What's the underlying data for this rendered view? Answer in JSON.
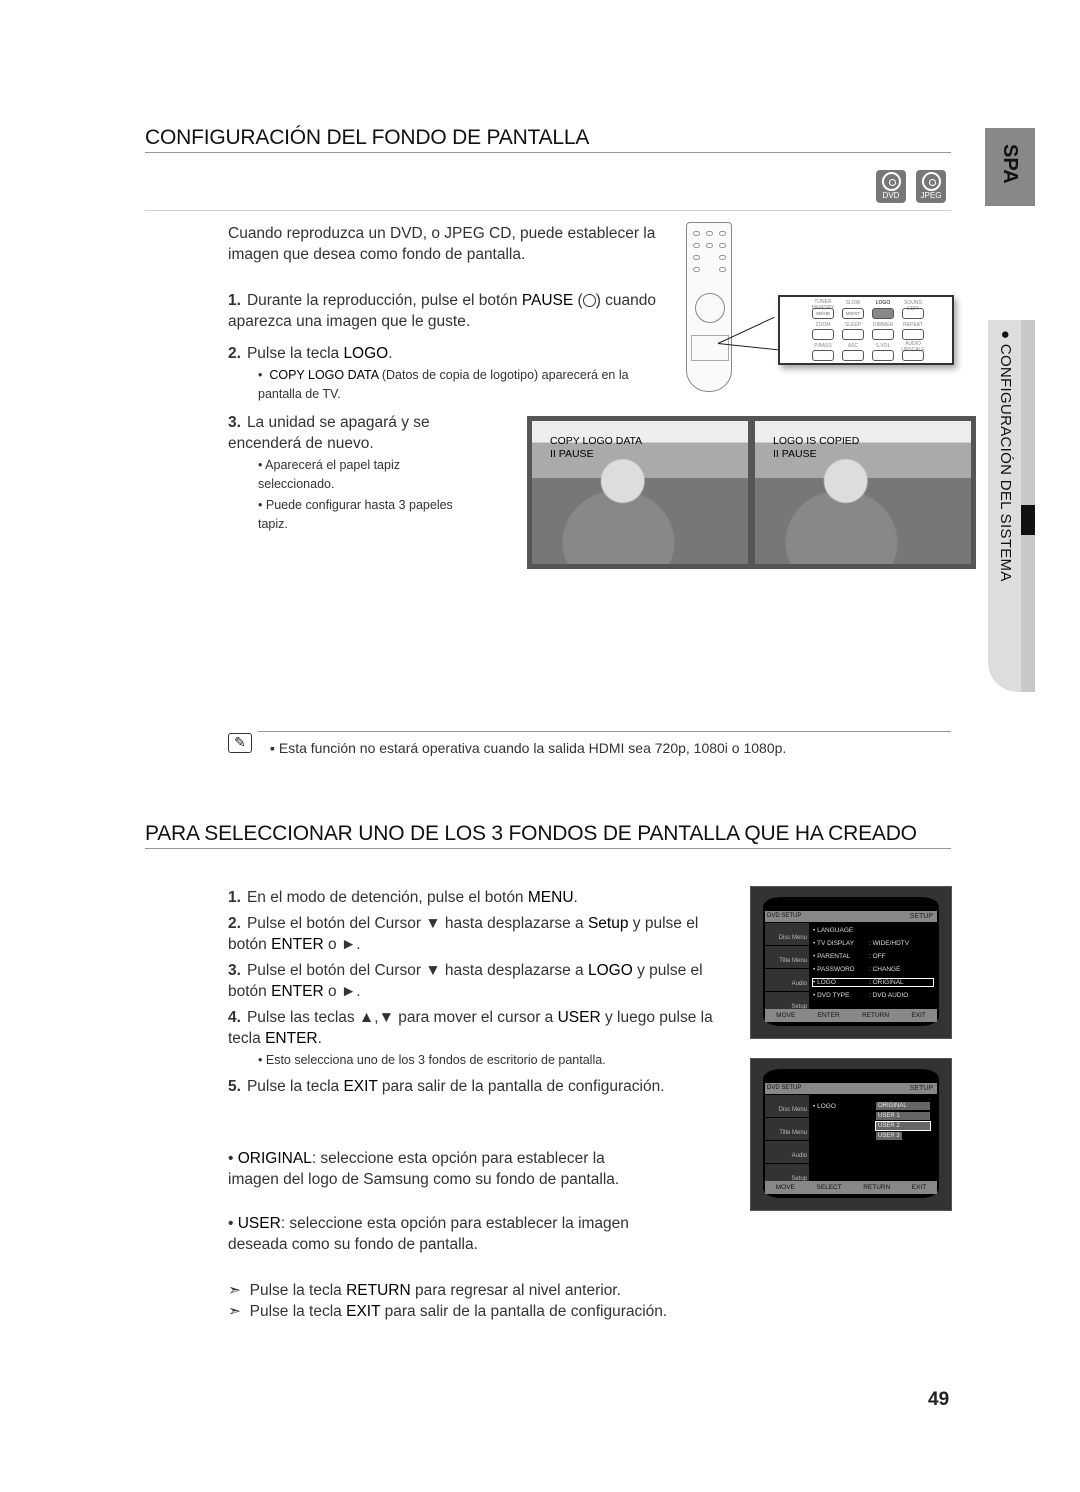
{
  "side_tab": {
    "lang": "SPA",
    "section": "CONFIGURACIÓN DEL SISTEMA"
  },
  "section1": {
    "title": "CONFIGURACIÓN DEL FONDO DE PANTALLA",
    "badges": [
      "DVD",
      "JPEG"
    ],
    "intro": "Cuando reproduzca un DVD, o JPEG CD, puede establecer la imagen que desea como fondo de pantalla.",
    "steps": [
      {
        "n": "1.",
        "pre": "Durante la reproducción, pulse el botón ",
        "key": "PAUSE",
        "post": " cuando aparezca una imagen que le guste."
      },
      {
        "n": "2.",
        "pre": "Pulse la tecla ",
        "key": "LOGO",
        "post": "."
      },
      {
        "n": "3.",
        "text": "La unidad se apagará y se encenderá de nuevo."
      }
    ],
    "step2_bullet_key": "COPY LOGO DATA",
    "step2_bullet_rest": " (Datos de copia de logotipo) aparecerá en la pantalla de TV.",
    "step3_bullets": [
      "Aparecerá el papel tapiz seleccionado.",
      "Puede configurar hasta 3 papeles tapiz."
    ],
    "screens": [
      {
        "line1": "COPY LOGO DATA",
        "line2": "II PAUSE"
      },
      {
        "line1": "LOGO IS COPIED",
        "line2": "II PAUSE"
      }
    ],
    "remote_keys": {
      "top": [
        "TUNER MEMORY",
        "SLOW",
        "LOGO",
        "SOUND EDIT"
      ],
      "row1": [
        "SD/HD",
        "MO/ST",
        "",
        ""
      ],
      "row2": [
        "ZOOM",
        "SLEEP",
        "DIMMER",
        "REPEAT"
      ],
      "row3": [
        "P.BASS",
        "ASC",
        "S.VOL",
        "AUDIO UPSCALE"
      ]
    },
    "note": "Esta función no estará operativa cuando la salida HDMI sea 720p, 1080i o 1080p."
  },
  "section2": {
    "title": "PARA SELECCIONAR UNO DE LOS 3 FONDOS DE PANTALLA QUE HA CREADO",
    "steps": [
      {
        "n": "1.",
        "html": [
          "En el modo de detención, pulse el botón ",
          "MENU",
          "."
        ]
      },
      {
        "n": "2.",
        "html": [
          "Pulse el botón del Cursor ▼ hasta desplazarse a ",
          "Setup",
          " y pulse el botón ",
          "ENTER",
          " o ►."
        ]
      },
      {
        "n": "3.",
        "html": [
          "Pulse el botón del Cursor ▼ hasta desplazarse a ",
          "LOGO",
          " y pulse el botón ",
          "ENTER",
          " o  ►."
        ]
      },
      {
        "n": "4.",
        "html": [
          "Pulse las teclas ▲,▼ para mover el cursor a ",
          "USER",
          " y luego pulse la tecla ",
          "ENTER",
          "."
        ]
      },
      {
        "n": "5.",
        "html": [
          "Pulse la tecla ",
          "EXIT",
          " para salir de la pantalla de configuración."
        ]
      }
    ],
    "step4_bullet": "Esto selecciona uno de los 3 fondos de escritorio de pantalla.",
    "original": {
      "key": "ORIGINAL",
      "text": ": seleccione esta opción para establecer la imagen del logo de Samsung como su fondo de pantalla."
    },
    "user": {
      "key": "USER",
      "text": ": seleccione esta opción para establecer la imagen deseada como su fondo de pantalla."
    },
    "tips": [
      [
        "Pulse la tecla ",
        "RETURN",
        " para regresar al nivel anterior."
      ],
      [
        "Pulse la tecla ",
        "EXIT",
        " para salir de la pantalla de configuración."
      ]
    ],
    "menu1": {
      "header": "SETUP",
      "tabs": [
        "Disc Menu",
        "Title Menu",
        "Audio",
        "Setup"
      ],
      "rows": [
        [
          "LANGUAGE",
          ""
        ],
        [
          "TV DISPLAY",
          ": WIDE/HDTV"
        ],
        [
          "PARENTAL",
          ": OFF"
        ],
        [
          "PASSWORD",
          ": CHANGE"
        ],
        [
          "LOGO",
          ": ORIGINAL"
        ],
        [
          "DVD TYPE",
          ": DVD AUDIO"
        ]
      ],
      "footer": [
        "MOVE",
        "ENTER",
        "RETURN",
        "EXIT"
      ]
    },
    "menu2": {
      "header": "SETUP",
      "tabs": [
        "Disc Menu",
        "Title Menu",
        "Audio",
        "Setup"
      ],
      "item": "LOGO",
      "options": [
        "ORIGINAL",
        "USER 1",
        "USER 2",
        "USER 3"
      ],
      "footer": [
        "MOVE",
        "SELECT",
        "RETURN",
        "EXIT"
      ]
    }
  },
  "page_number": "49"
}
